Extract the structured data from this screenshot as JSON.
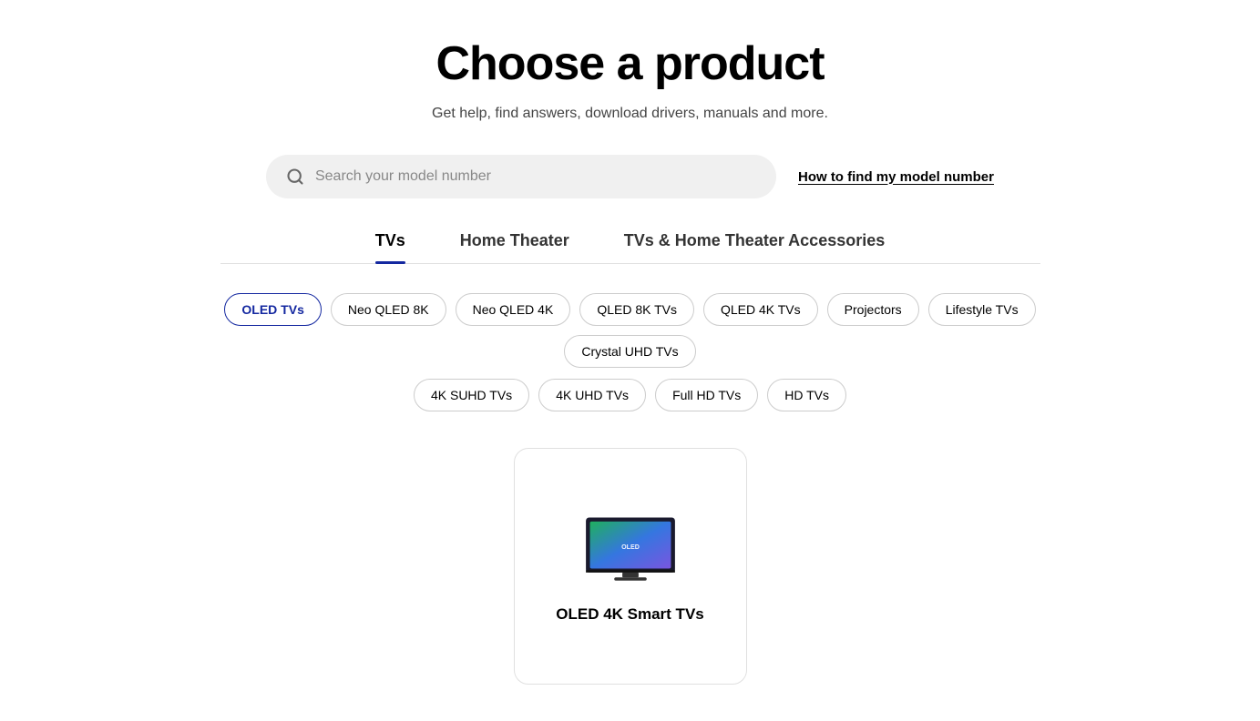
{
  "page": {
    "title": "Choose a product",
    "subtitle": "Get help, find answers, download drivers, manuals and more."
  },
  "search": {
    "placeholder": "Search your model number",
    "model_number_link": "How to find my model number"
  },
  "tabs": [
    {
      "id": "tvs",
      "label": "TVs",
      "active": true
    },
    {
      "id": "home-theater",
      "label": "Home Theater",
      "active": false
    },
    {
      "id": "accessories",
      "label": "TVs & Home Theater Accessories",
      "active": false
    }
  ],
  "filters_row1": [
    {
      "id": "oled-tvs",
      "label": "OLED TVs",
      "active": true
    },
    {
      "id": "neo-qled-8k",
      "label": "Neo QLED 8K",
      "active": false
    },
    {
      "id": "neo-qled-4k",
      "label": "Neo QLED 4K",
      "active": false
    },
    {
      "id": "qled-8k-tvs",
      "label": "QLED 8K TVs",
      "active": false
    },
    {
      "id": "qled-4k-tvs",
      "label": "QLED 4K TVs",
      "active": false
    },
    {
      "id": "projectors",
      "label": "Projectors",
      "active": false
    },
    {
      "id": "lifestyle-tvs",
      "label": "Lifestyle TVs",
      "active": false
    },
    {
      "id": "crystal-uhd-tvs",
      "label": "Crystal UHD TVs",
      "active": false
    }
  ],
  "filters_row2": [
    {
      "id": "4k-suhd-tvs",
      "label": "4K SUHD TVs",
      "active": false
    },
    {
      "id": "4k-uhd-tvs",
      "label": "4K UHD TVs",
      "active": false
    },
    {
      "id": "full-hd-tvs",
      "label": "Full HD TVs",
      "active": false
    },
    {
      "id": "hd-tvs",
      "label": "HD TVs",
      "active": false
    }
  ],
  "products": [
    {
      "id": "oled-4k-smart-tvs",
      "label": "OLED 4K Smart TVs"
    }
  ]
}
